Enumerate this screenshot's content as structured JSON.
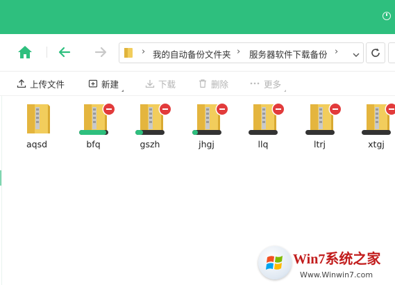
{
  "breadcrumb": [
    "我的自动备份文件夹",
    "服务器软件下载备份"
  ],
  "toolbar": {
    "upload": "上传文件",
    "new": "新建",
    "download": "下载",
    "delete": "删除",
    "more": "更多"
  },
  "items": [
    {
      "name": "aqsd",
      "syncing": false,
      "progress": null
    },
    {
      "name": "bfq",
      "syncing": true,
      "progress": 0.95
    },
    {
      "name": "gszh",
      "syncing": true,
      "progress": 0.25
    },
    {
      "name": "jhgj",
      "syncing": true,
      "progress": 0.2
    },
    {
      "name": "llq",
      "syncing": true,
      "progress": 0
    },
    {
      "name": "ltrj",
      "syncing": true,
      "progress": 0
    },
    {
      "name": "xtgj",
      "syncing": true,
      "progress": 0
    }
  ],
  "watermark": {
    "title": "Win7系统之家",
    "url": "Www.Winwin7.com"
  },
  "colors": {
    "accent": "#2ebf7e",
    "badge": "#e23b3b",
    "folder": "#f2cd5c"
  }
}
